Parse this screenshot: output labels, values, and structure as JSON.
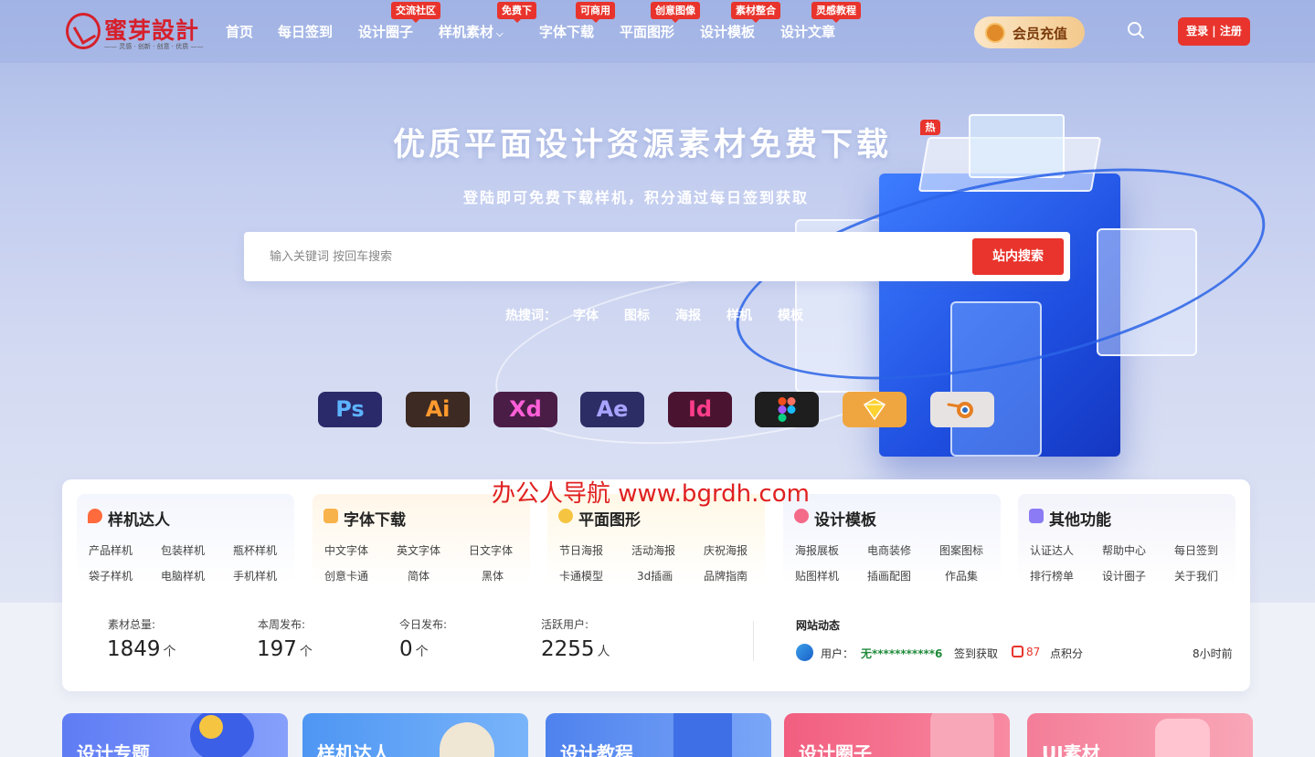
{
  "logo": {
    "name": "蜜芽設計",
    "tagline": "—— 灵感 · 创新 · 创意 · 优质 ——"
  },
  "nav": {
    "items": [
      {
        "label": "首页",
        "badge": ""
      },
      {
        "label": "每日签到",
        "badge": ""
      },
      {
        "label": "设计圈子",
        "badge": "交流社区"
      },
      {
        "label": "样机素材",
        "badge": "免费下"
      },
      {
        "label": "字体下载",
        "badge": "可商用"
      },
      {
        "label": "平面图形",
        "badge": "创意图像"
      },
      {
        "label": "设计模板",
        "badge": "素材整合"
      },
      {
        "label": "设计文章",
        "badge": "灵感教程"
      }
    ],
    "vip_label": "会员充值",
    "login_label": "登录 | 注册"
  },
  "hero": {
    "title": "优质平面设计资源素材免费下载",
    "hot_tag": "热",
    "subtitle": "登陆即可免费下载样机，积分通过每日签到获取",
    "search_placeholder": "输入关键词 按回车搜索",
    "search_button": "站内搜索",
    "hotwords_label": "热搜词：",
    "hotwords": [
      "字体",
      "图标",
      "海报",
      "样机",
      "模板"
    ],
    "apps": [
      {
        "label": "Ps",
        "bg": "#2a2a6a",
        "fg": "#5db3ff"
      },
      {
        "label": "Ai",
        "bg": "#3d2a22",
        "fg": "#ff9a2e"
      },
      {
        "label": "Xd",
        "bg": "#4a1d47",
        "fg": "#ff5fd8"
      },
      {
        "label": "Ae",
        "bg": "#2d2d66",
        "fg": "#a8a4ff"
      },
      {
        "label": "Id",
        "bg": "#4a1430",
        "fg": "#ff3d8a"
      },
      {
        "label": "",
        "bg": "#1e1e1e",
        "fg": "#fff"
      },
      {
        "label": "",
        "bg": "#f0a640",
        "fg": "#fff"
      },
      {
        "label": "",
        "bg": "#e7e3e2",
        "fg": "#e67f23"
      }
    ]
  },
  "watermark": "办公人导航 www.bgrdh.com",
  "categories": [
    {
      "title": "样机达人",
      "color": "#fff1f0",
      "icon": "flame-icon",
      "links": [
        "产品样机",
        "包装样机",
        "瓶杯样机",
        "袋子样机",
        "电脑样机",
        "手机样机"
      ]
    },
    {
      "title": "字体下载",
      "color": "#fff6e8",
      "icon": "font-icon",
      "links": [
        "中文字体",
        "英文字体",
        "日文字体",
        "创意卡通",
        "简体",
        "黑体"
      ]
    },
    {
      "title": "平面图形",
      "color": "#fff9e6",
      "icon": "shape-icon",
      "links": [
        "节日海报",
        "活动海报",
        "庆祝海报",
        "卡通模型",
        "3d插画",
        "品牌指南"
      ]
    },
    {
      "title": "设计模板",
      "color": "#f2f4fd",
      "icon": "template-icon",
      "links": [
        "海报展板",
        "电商装修",
        "图案图标",
        "贴图样机",
        "插画配图",
        "作品集"
      ]
    },
    {
      "title": "其他功能",
      "color": "#f3f3fb",
      "icon": "more-icon",
      "links": [
        "认证达人",
        "帮助中心",
        "每日签到",
        "排行榜单",
        "设计圈子",
        "关于我们"
      ]
    }
  ],
  "stats": [
    {
      "label": "素材总量:",
      "value": "1849",
      "unit": "个"
    },
    {
      "label": "本周发布:",
      "value": "197",
      "unit": "个"
    },
    {
      "label": "今日发布:",
      "value": "0",
      "unit": "个"
    },
    {
      "label": "活跃用户:",
      "value": "2255",
      "unit": "人"
    }
  ],
  "news": {
    "title": "网站动态",
    "user_prefix": "用户：",
    "user_name": "无***********6",
    "action": "签到获取",
    "points": "87",
    "points_unit": "点积分",
    "time": "8小时前"
  },
  "bottom_cards": [
    {
      "label": "设计专题",
      "bg": "#6f8cf5"
    },
    {
      "label": "样机达人",
      "bg": "#5aa3f5"
    },
    {
      "label": "设计教程",
      "bg": "#5b8cf2"
    },
    {
      "label": "设计圈子",
      "bg": "#f4728a"
    },
    {
      "label": "UI素材",
      "bg": "#f48aa0"
    }
  ]
}
